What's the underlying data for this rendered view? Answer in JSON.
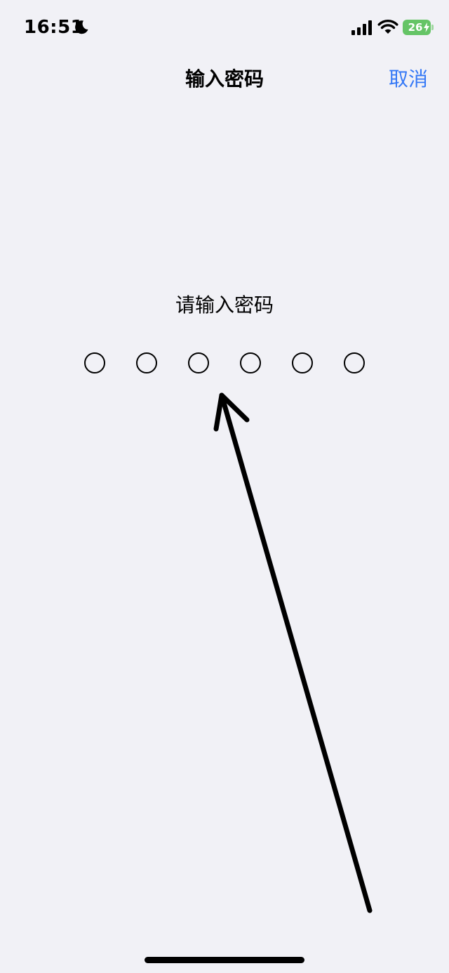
{
  "status_bar": {
    "time": "16:51",
    "battery_level": "26",
    "icons": [
      "moon-icon",
      "signal-icon",
      "wifi-icon",
      "battery-icon"
    ],
    "battery_color": "#65c466"
  },
  "nav": {
    "title": "输入密码",
    "cancel_label": "取消",
    "accent_color": "#3478f6"
  },
  "passcode": {
    "prompt": "请输入密码",
    "digits_total": 6,
    "digits_entered": 0
  },
  "background_color": "#f1f1f6"
}
